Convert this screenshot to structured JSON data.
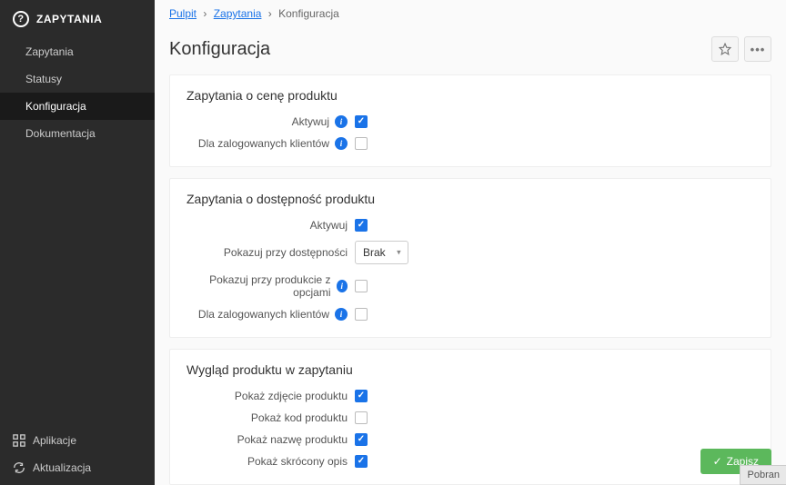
{
  "sidebar": {
    "title": "ZAPYTANIA",
    "items": [
      {
        "label": "Zapytania",
        "active": false
      },
      {
        "label": "Statusy",
        "active": false
      },
      {
        "label": "Konfiguracja",
        "active": true
      },
      {
        "label": "Dokumentacja",
        "active": false
      }
    ],
    "footer": {
      "apps": "Aplikacje",
      "update": "Aktualizacja"
    }
  },
  "breadcrumb": {
    "dashboard": "Pulpit",
    "module": "Zapytania",
    "current": "Konfiguracja"
  },
  "page_title": "Konfiguracja",
  "sections": {
    "price": {
      "title": "Zapytania o cenę produktu",
      "activate_label": "Aktywuj",
      "activate_checked": true,
      "logged_label": "Dla zalogowanych klientów",
      "logged_checked": false
    },
    "availability": {
      "title": "Zapytania o dostępność produktu",
      "activate_label": "Aktywuj",
      "activate_checked": true,
      "show_on_avail_label": "Pokazuj przy dostępności",
      "show_on_avail_value": "Brak",
      "options_label": "Pokazuj przy produkcie z opcjami",
      "options_checked": false,
      "logged_label": "Dla zalogowanych klientów",
      "logged_checked": false
    },
    "appearance": {
      "title": "Wygląd produktu w zapytaniu",
      "photo_label": "Pokaż zdjęcie produktu",
      "photo_checked": true,
      "code_label": "Pokaż kod produktu",
      "code_checked": false,
      "name_label": "Pokaż nazwę produktu",
      "name_checked": true,
      "short_label": "Pokaż skrócony opis",
      "short_checked": true
    }
  },
  "save_button": "Zapisz",
  "toast": "Pobran"
}
